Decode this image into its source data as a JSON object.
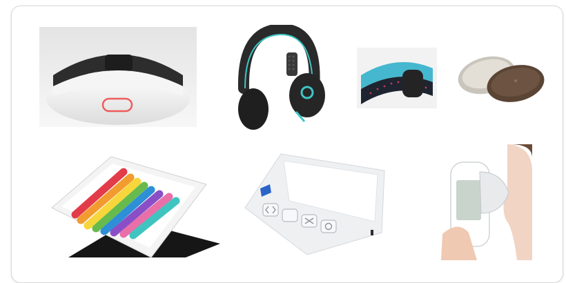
{
  "gallery": {
    "items": [
      {
        "name": "smoke-detector-image"
      },
      {
        "name": "headphones-image"
      },
      {
        "name": "wristband-image"
      },
      {
        "name": "pebble-device-image"
      },
      {
        "name": "tablet-stand-image"
      },
      {
        "name": "handheld-monitor-image"
      },
      {
        "name": "spirometer-image"
      }
    ]
  },
  "colors": {
    "card_border": "#d9d9d9",
    "accent_teal": "#3ec6c6",
    "led_red": "#f05a5a",
    "device_white": "#f3f4f6",
    "device_dark": "#2b2b2b"
  }
}
